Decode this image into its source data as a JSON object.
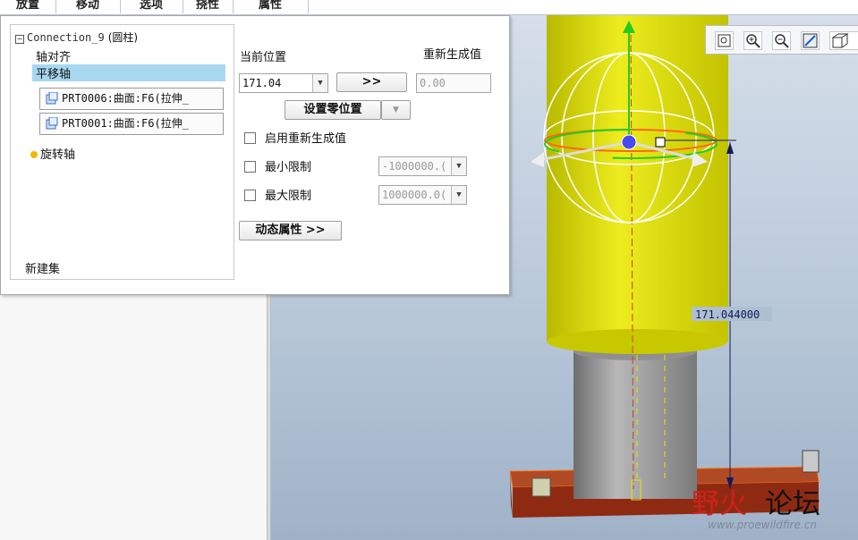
{
  "tabs": [
    "放置",
    "移动",
    "选项",
    "挠性",
    "属性"
  ],
  "tree": {
    "connection": "Connection_9",
    "connection_type": "(圆柱)",
    "axis_align": "轴对齐",
    "translation_axis": "平移轴",
    "references": [
      "PRT0006:曲面:F6(拉伸_",
      "PRT0001:曲面:F6(拉伸_"
    ],
    "rotation_axis": "旋转轴",
    "new_set": "新建集"
  },
  "controls": {
    "current_position_label": "当前位置",
    "current_position_value": "171.04",
    "arrow_button": ">>",
    "regen_label": "重新生成值",
    "regen_value": "0.00",
    "set_zero_button": "设置零位置",
    "enable_regen_label": "启用重新生成值",
    "min_limit_label": "最小限制",
    "min_limit_value": "-1000000.(",
    "max_limit_label": "最大限制",
    "max_limit_value": "1000000.0(",
    "dynamic_props_button": "动态属性 >>"
  },
  "dimension_value": "171.044000",
  "watermark": {
    "cn_part1": "野火",
    "cn_part2": "论坛",
    "url": "www.proewildfire.cn"
  },
  "colors": {
    "cylinder_yellow": "#dcdc00",
    "cylinder_grey": "#9c9c9c",
    "base_red": "#a33a1c",
    "highlight_row": "#a8d8f0",
    "dim_blue": "#141a5a"
  },
  "icons": [
    "zoom-fit-icon",
    "zoom-in-icon",
    "zoom-out-icon",
    "repaint-icon",
    "view-cube-icon"
  ]
}
